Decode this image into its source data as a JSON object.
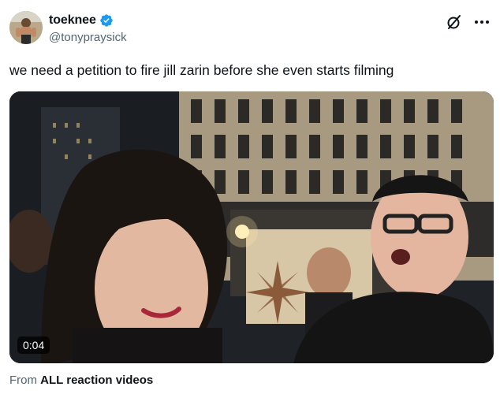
{
  "author": {
    "display_name": "toeknee",
    "handle": "@tonypraysick",
    "verified_icon": "verified-badge-icon",
    "avatar_icon": "avatar"
  },
  "actions": {
    "grok_icon": "grok-icon",
    "more_icon": "more-options-icon"
  },
  "tweet": {
    "text": "we need a petition to fire jill zarin before she even starts filming"
  },
  "media": {
    "type": "video",
    "duration": "0:04"
  },
  "source": {
    "prefix": "From",
    "name": "ALL reaction videos"
  },
  "colors": {
    "verified": "#1d9bf0",
    "secondary_text": "#536471",
    "primary_text": "#0f1419"
  }
}
